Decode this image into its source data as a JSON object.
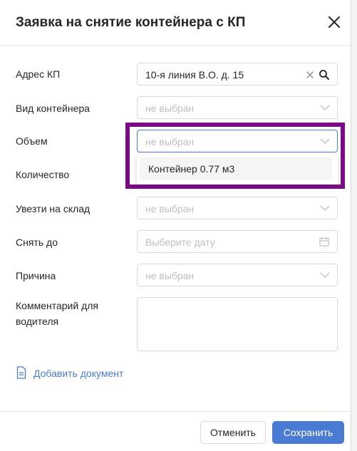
{
  "dialog": {
    "title": "Заявка на снятие контейнера с КП"
  },
  "form": {
    "address": {
      "label": "Адрес КП",
      "value": "10-я линия В.О. д. 15"
    },
    "container_type": {
      "label": "Вид контейнера",
      "placeholder": "не выбран"
    },
    "volume": {
      "label": "Объем",
      "placeholder": "не выбран",
      "options": [
        "Контейнер 0.77 м3"
      ]
    },
    "quantity": {
      "label": "Количество"
    },
    "warehouse": {
      "label": "Увезти на склад",
      "placeholder": "не выбран"
    },
    "remove_by": {
      "label": "Снять до",
      "placeholder": "Выберите дату"
    },
    "reason": {
      "label": "Причина",
      "placeholder": "не выбран"
    },
    "comment": {
      "label": "Комментарий для водителя",
      "value": ""
    },
    "add_document": "Добавить документ"
  },
  "footer": {
    "cancel_label": "Отменить",
    "save_label": "Сохранить"
  },
  "colors": {
    "accent": "#4a7bd4",
    "highlight_border": "#7b0a86"
  }
}
